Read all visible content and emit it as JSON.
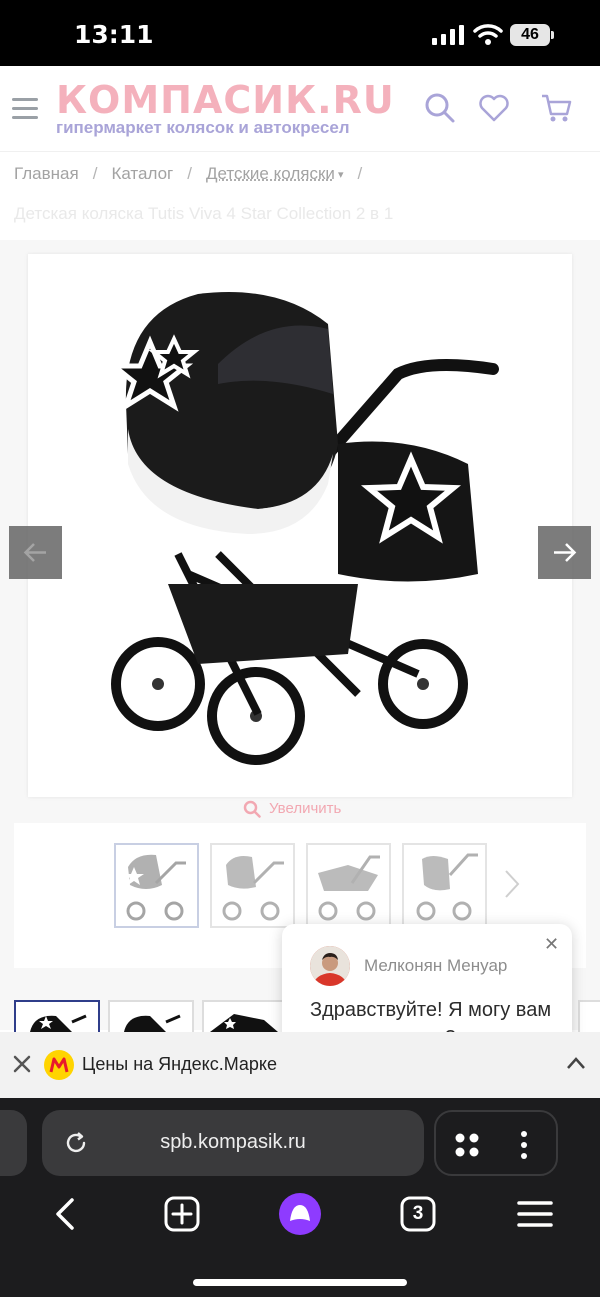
{
  "status_bar": {
    "time": "13:11",
    "battery": "46"
  },
  "header": {
    "brand": "КОМПАСИК.RU",
    "tagline": "гипермаркет колясок и автокресел"
  },
  "breadcrumbs": [
    {
      "label": "Главная"
    },
    {
      "label": "Каталог"
    },
    {
      "label": "Детские коляски"
    }
  ],
  "product": {
    "title": "Детская коляска Tutis Viva 4 Star Collection 2 в 1"
  },
  "gallery": {
    "zoom_label": "Увеличить"
  },
  "chat": {
    "agent_name": "Мелконян Менуар",
    "message": "Здравствуйте! Я могу вам чем-то помочь?"
  },
  "market_banner": {
    "text": "Цены на Яндекс.Марке"
  },
  "browser": {
    "url": "spb.kompasik.ru",
    "tabs_count": "3"
  },
  "colors": {
    "brand_pink": "#f4b1bc",
    "brand_violet": "#a9a4d8",
    "alice_purple": "#8e3bff"
  }
}
